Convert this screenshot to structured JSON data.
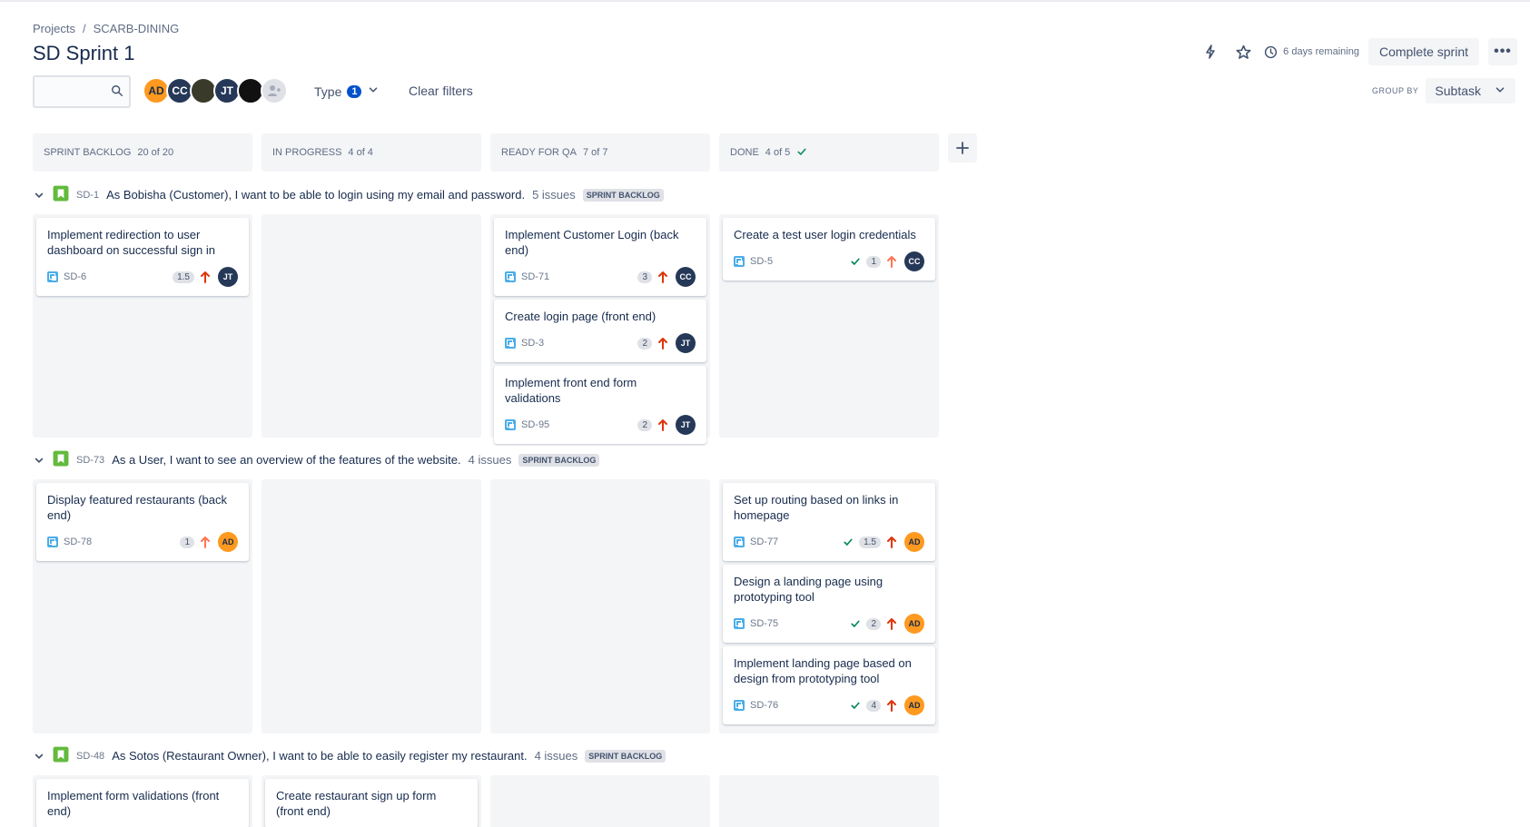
{
  "breadcrumb": {
    "projects": "Projects",
    "separator": "/",
    "project": "SCARB-DINING"
  },
  "title": "SD Sprint 1",
  "header": {
    "days_remaining": "6 days remaining",
    "complete_sprint": "Complete sprint",
    "more": "•••"
  },
  "filters": {
    "search_placeholder": "",
    "avatars": [
      "AD",
      "CC",
      "",
      "JT",
      ""
    ],
    "type_label": "Type",
    "type_count": "1",
    "clear_filters": "Clear filters",
    "group_by_label": "GROUP BY",
    "group_by_value": "Subtask"
  },
  "columns": [
    {
      "name": "Sprint backlog",
      "count": "20 of 20"
    },
    {
      "name": "In progress",
      "count": "4 of 4"
    },
    {
      "name": "Ready for QA",
      "count": "7 of 7"
    },
    {
      "name": "Done",
      "count": "4 of 5"
    }
  ],
  "colors": {
    "accent": "#0052cc",
    "story_icon": "#63ba3c",
    "subtask_icon": "#4bade8",
    "priority_high": "#de350b",
    "priority_medium": "#ff7452",
    "done_check": "#00875a"
  },
  "lanes": [
    {
      "key": "SD-1",
      "summary": "As Bobisha (Customer), I want to be able to login using my email and password.",
      "count": "5 issues",
      "status": "SPRINT BACKLOG",
      "cards": [
        [
          {
            "title": "Implement redirection to user dashboard on successful sign in",
            "key": "SD-6",
            "estimate": "1.5",
            "assignee": "JT"
          }
        ],
        [],
        [
          {
            "title": "Implement Customer Login (back end)",
            "key": "SD-71",
            "estimate": "3",
            "assignee": "CC"
          },
          {
            "title": "Create login page (front end)",
            "key": "SD-3",
            "estimate": "2",
            "assignee": "JT"
          },
          {
            "title": "Implement front end form validations",
            "key": "SD-95",
            "estimate": "2",
            "assignee": "JT"
          }
        ],
        [
          {
            "title": "Create a test user login credentials",
            "key": "SD-5",
            "estimate": "1",
            "assignee": "CC"
          }
        ]
      ]
    },
    {
      "key": "SD-73",
      "summary": "As a User, I want to see an overview of the features of the website.",
      "count": "4 issues",
      "status": "SPRINT BACKLOG",
      "cards": [
        [
          {
            "title": "Display featured restaurants (back end)",
            "key": "SD-78",
            "estimate": "1",
            "assignee": "AD"
          }
        ],
        [],
        [],
        [
          {
            "title": "Set up routing based on links in homepage",
            "key": "SD-77",
            "estimate": "1.5",
            "assignee": "AD"
          },
          {
            "title": "Design a landing page using prototyping tool",
            "key": "SD-75",
            "estimate": "2",
            "assignee": "AD"
          },
          {
            "title": "Implement landing page based on design from prototyping tool",
            "key": "SD-76",
            "estimate": "4",
            "assignee": "AD"
          }
        ]
      ]
    },
    {
      "key": "SD-48",
      "summary": "As Sotos (Restaurant Owner), I want to be able to easily register my restaurant.",
      "count": "4 issues",
      "status": "SPRINT BACKLOG",
      "cards": [
        [
          {
            "title": "Implement form validations (front end)"
          }
        ],
        [
          {
            "title": "Create restaurant sign up form (front end)"
          }
        ],
        [],
        []
      ]
    }
  ]
}
